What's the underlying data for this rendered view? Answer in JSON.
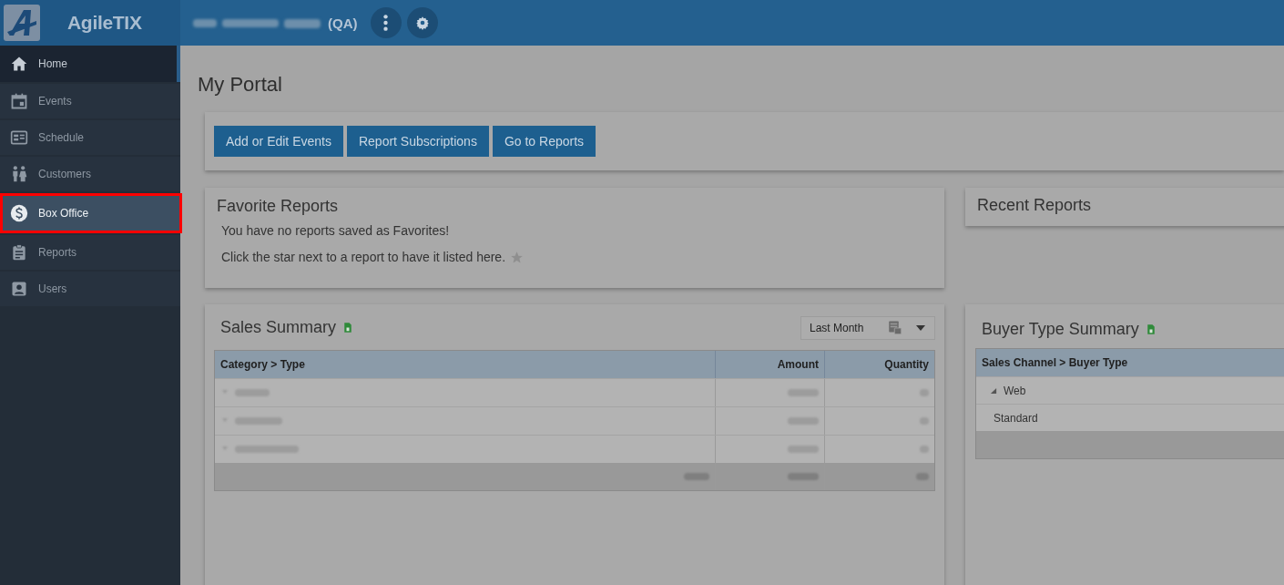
{
  "app": {
    "name": "AgileTIX",
    "environment": "(QA)"
  },
  "header_buttons": [
    {
      "kind": "more"
    },
    {
      "kind": "settings"
    }
  ],
  "sidebar": {
    "items": [
      {
        "label": "Home",
        "kind": "home",
        "selected": true,
        "highlighted": false
      },
      {
        "label": "Events",
        "kind": "calendar",
        "selected": false,
        "highlighted": false
      },
      {
        "label": "Schedule",
        "kind": "schedule",
        "selected": false,
        "highlighted": false
      },
      {
        "label": "Customers",
        "kind": "people",
        "selected": false,
        "highlighted": false
      },
      {
        "label": "Box Office",
        "kind": "dollar",
        "selected": false,
        "highlighted": true
      },
      {
        "label": "Reports",
        "kind": "clipboard",
        "selected": false,
        "highlighted": false
      },
      {
        "label": "Users",
        "kind": "user",
        "selected": false,
        "highlighted": false
      }
    ]
  },
  "page": {
    "title": "My Portal",
    "buttons": [
      "Add or Edit Events",
      "Report Subscriptions",
      "Go to Reports"
    ]
  },
  "favorite_reports": {
    "title": "Favorite Reports",
    "lines": [
      "You have no reports saved as Favorites!",
      "Click the star next to a report to have it listed here."
    ]
  },
  "recent_reports": {
    "title": "Recent Reports"
  },
  "sales_summary": {
    "title": "Sales Summary",
    "period": "Last Month",
    "columns": [
      "Category > Type",
      "Amount",
      "Quantity"
    ]
  },
  "buyer_type_summary": {
    "title": "Buyer Type Summary",
    "column": "Sales Channel > Buyer Type",
    "rows": [
      {
        "label": "Web",
        "expanded": true,
        "children": [
          {
            "label": "Standard"
          }
        ]
      }
    ]
  }
}
